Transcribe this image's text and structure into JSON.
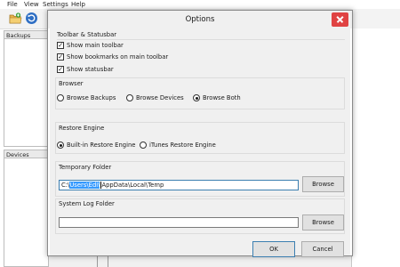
{
  "menu": [
    "File",
    "View",
    "Settings",
    "Help"
  ],
  "toolbar": {
    "icons": [
      "open-folder-icon",
      "refresh-icon"
    ]
  },
  "panels": {
    "backups_label": "Backups",
    "devices_label": "Devices"
  },
  "dialog": {
    "title": "Options",
    "toolbar_statusbar": {
      "title": "Toolbar & Statusbar",
      "show_main_toolbar": "Show main toolbar",
      "show_bookmarks": "Show bookmarks on main toolbar",
      "show_statusbar": "Show statusbar"
    },
    "browser": {
      "title": "Browser",
      "options": [
        "Browse Backups",
        "Browse Devices",
        "Browse Both"
      ],
      "selected": "Browse Both"
    },
    "restore_engine": {
      "title": "Restore Engine",
      "options": [
        "Built-in Restore Engine",
        "iTunes Restore Engine"
      ],
      "selected": "Built-in Restore Engine"
    },
    "temporary_folder": {
      "title": "Temporary Folder",
      "value_prefix": "C:\\",
      "value_selected": "Users\\Edi\\",
      "value_suffix": "AppData\\Local\\Temp",
      "browse_label": "Browse"
    },
    "system_log_folder": {
      "title": "System Log Folder",
      "value": "",
      "browse_label": "Browse"
    },
    "ok_label": "OK",
    "cancel_label": "Cancel"
  },
  "colors": {
    "selection": "#3399ff",
    "close_button": "#e04343",
    "focus_border": "#3c7fb1"
  }
}
